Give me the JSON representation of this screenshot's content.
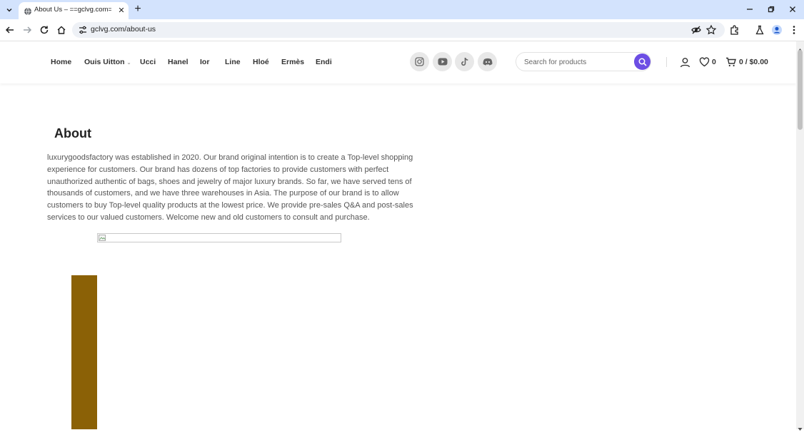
{
  "browser": {
    "tab_title": "About Us – ==gclvg.com==",
    "url": "gclvg.com/about-us",
    "new_tab_symbol": "+",
    "close_symbol": "✕"
  },
  "site": {
    "menu": [
      {
        "label": "Home",
        "has_dropdown": false
      },
      {
        "label": "Ouis Uitton",
        "has_dropdown": true
      },
      {
        "label": "Ucci",
        "has_dropdown": false
      },
      {
        "label": "Hanel",
        "has_dropdown": false
      },
      {
        "label": "Ior",
        "has_dropdown": false
      },
      {
        "label": "Line",
        "has_dropdown": false
      },
      {
        "label": "Hloé",
        "has_dropdown": false
      },
      {
        "label": "Ermès",
        "has_dropdown": false
      },
      {
        "label": "Endi",
        "has_dropdown": false
      }
    ],
    "social_icons": [
      "instagram-icon",
      "youtube-icon",
      "tiktok-icon",
      "discord-icon"
    ],
    "search": {
      "placeholder": "Search for products"
    },
    "wishlist_count": "0",
    "cart_text": "0 / $0.00",
    "colors": {
      "accent": "#6c4ee4",
      "brown_block": "#8b6106"
    }
  },
  "content": {
    "title": "About",
    "body": "luxurygoodsfactory  was established in 2020. Our brand original intention is to create a Top-level shopping experience for customers. Our brand has dozens of top factories to provide customers with perfect unauthorized authentic of bags, shoes and jewelry of major luxury brands. So far, we have served tens of thousands of customers, and we have three warehouses in Asia. The purpose of our brand is to allow customers to buy Top-level quality products at the lowest price. We provide pre-sales Q&A and post-sales services to our valued customers. Welcome new and old customers to consult and purchase."
  }
}
